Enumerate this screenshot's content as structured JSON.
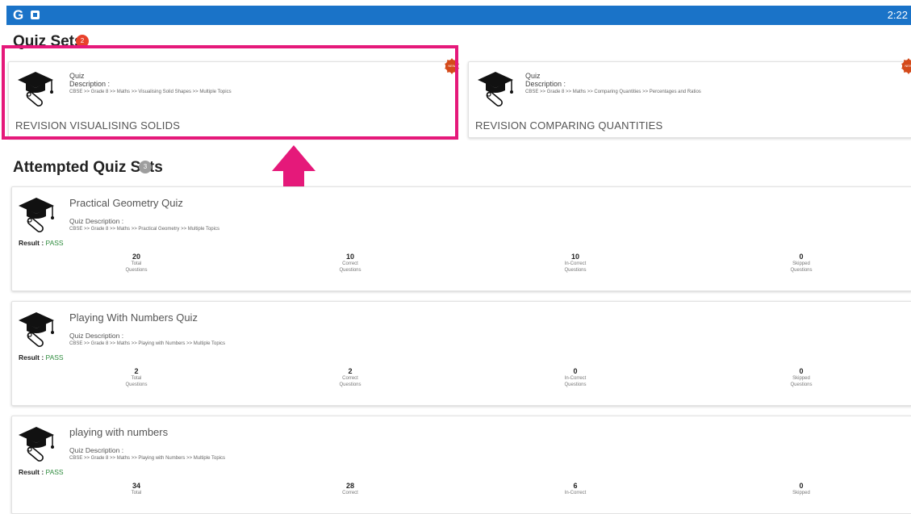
{
  "statusbar": {
    "app_icon": "G",
    "time": "2:22"
  },
  "quiz_sets": {
    "title": "Quiz Sets",
    "count": "2",
    "cards": [
      {
        "type_label": "Quiz",
        "desc_label": "Description :",
        "breadcrumb": "CBSE >> Grade 8 >> Maths >> Visualising Solid Shapes >> Multiple Topics",
        "name": "REVISION VISUALISING SOLIDS",
        "seal_text": "NEW"
      },
      {
        "type_label": "Quiz",
        "desc_label": "Description :",
        "breadcrumb": "CBSE >> Grade 8 >> Maths >> Comparing Quantities >> Percentages and Ratios",
        "name": "REVISION COMPARING QUANTITIES",
        "seal_text": "NEW"
      }
    ]
  },
  "attempted": {
    "title": "Attempted Quiz Sets",
    "count": "3",
    "result_label": "Result :",
    "desc_label": "Quiz Description :",
    "items": [
      {
        "title": "Practical Geometry Quiz",
        "breadcrumb": "CBSE >> Grade 8 >> Maths >> Practical Geometry >> Multiple Topics",
        "result": "PASS",
        "stats": [
          {
            "value": "20",
            "label1": "Total",
            "label2": "Questions"
          },
          {
            "value": "10",
            "label1": "Correct",
            "label2": "Questions"
          },
          {
            "value": "10",
            "label1": "In-Correct",
            "label2": "Questions"
          },
          {
            "value": "0",
            "label1": "Skipped",
            "label2": "Questions"
          }
        ]
      },
      {
        "title": "Playing With Numbers Quiz",
        "breadcrumb": "CBSE >> Grade 8 >> Maths >> Playing with Numbers >> Multiple Topics",
        "result": "PASS",
        "stats": [
          {
            "value": "2",
            "label1": "Total",
            "label2": "Questions"
          },
          {
            "value": "2",
            "label1": "Correct",
            "label2": "Questions"
          },
          {
            "value": "0",
            "label1": "In-Correct",
            "label2": "Questions"
          },
          {
            "value": "0",
            "label1": "Skipped",
            "label2": "Questions"
          }
        ]
      },
      {
        "title": "playing with numbers",
        "breadcrumb": "CBSE >> Grade 8 >> Maths >> Playing with Numbers >> Multiple Topics",
        "result": "PASS",
        "stats": [
          {
            "value": "34",
            "label1": "Total",
            "label2": ""
          },
          {
            "value": "28",
            "label1": "Correct",
            "label2": ""
          },
          {
            "value": "6",
            "label1": "In-Correct",
            "label2": ""
          },
          {
            "value": "0",
            "label1": "Skipped",
            "label2": ""
          }
        ]
      }
    ]
  },
  "colors": {
    "statusbar": "#1a73c8",
    "highlight": "#e5197a",
    "pass": "#2e8b3d",
    "badge_new": "#e8412b",
    "badge_attempted": "#9e9e9e"
  },
  "icons": {
    "quiz_icon": "graduation-cap-icon",
    "highlight_arrow": "up-arrow-icon"
  }
}
